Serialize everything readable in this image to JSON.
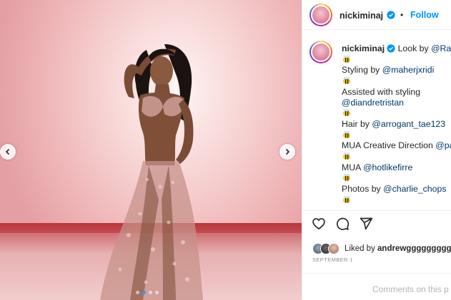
{
  "post": {
    "username": "nickiminaj",
    "separator": "•",
    "follow_label": "Follow"
  },
  "caption": {
    "username": "nickiminaj",
    "lines": [
      {
        "prefix": "Look by ",
        "mention": "@Raba"
      },
      {
        "prefix": "Styling by ",
        "mention": "@maherjxridi"
      },
      {
        "prefix": "Assisted with styling",
        "mention": ""
      },
      {
        "prefix": "",
        "mention": "@diandretristan"
      },
      {
        "prefix": "Hair by ",
        "mention": "@arrogant_tae123"
      },
      {
        "prefix": "MUA Creative Direction ",
        "mention": "@pa"
      },
      {
        "prefix": "MUA ",
        "mention": "@hotlikefirre"
      },
      {
        "prefix": "Photos by ",
        "mention": "@charlie_chops"
      }
    ]
  },
  "icons": {
    "emoji": "bee-emoji-icon",
    "verified": "verified-badge-icon",
    "like": "heart-icon",
    "comment": "comment-bubble-icon",
    "share": "paper-plane-icon",
    "prev": "chevron-left-icon",
    "next": "chevron-right-icon"
  },
  "likes": {
    "prefix": "Liked by ",
    "user": "andrewggggggggg"
  },
  "date": "SEPTEMBER 1",
  "comment": {
    "placeholder": "Comments on this p"
  },
  "colors": {
    "link": "#0095f6",
    "mention": "#00376b",
    "muted": "#8e8e8e"
  }
}
